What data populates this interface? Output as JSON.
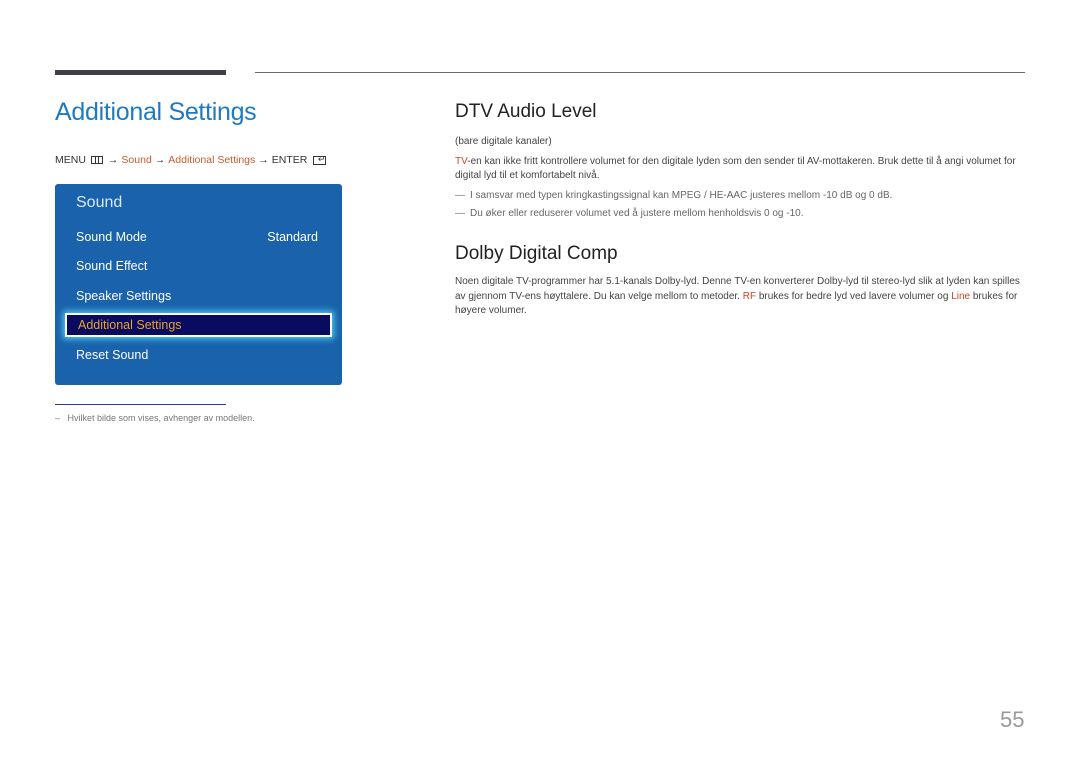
{
  "page": {
    "title": "Additional Settings",
    "page_number": "55"
  },
  "menu_path": {
    "menu_label": "MENU",
    "arrow": "→",
    "items": [
      "Sound",
      "Additional Settings"
    ],
    "enter_label": "ENTER"
  },
  "osd": {
    "title": "Sound",
    "items": [
      {
        "label": "Sound Mode",
        "value": "Standard"
      },
      {
        "label": "Sound Effect",
        "value": ""
      },
      {
        "label": "Speaker Settings",
        "value": ""
      },
      {
        "label": "Additional Settings",
        "value": "",
        "selected": true
      },
      {
        "label": "Reset Sound",
        "value": ""
      }
    ],
    "colors": {
      "panel": "#1a62ac",
      "selected_bg": "#0a0a60",
      "selected_text": "#e5a52a"
    }
  },
  "footnote": {
    "dash": "–",
    "text": "Hvilket bilde som vises, avhenger av modellen."
  },
  "dtv_audio_level": {
    "heading": "DTV Audio Level",
    "subtitle": "(bare digitale kanaler)",
    "body_highlight": "TV",
    "body_rest": "-en kan ikke fritt kontrollere volumet for den digitale lyden som den sender til AV-mottakeren. Bruk dette til å angi volumet for digital lyd til et komfortabelt nivå.",
    "notes": [
      "I samsvar med typen kringkastingssignal kan MPEG / HE-AAC justeres mellom -10 dB og 0 dB.",
      "Du øker eller reduserer volumet ved å justere mellom henholdsvis 0 og -10."
    ]
  },
  "dolby_digital_comp": {
    "heading": "Dolby Digital Comp",
    "body_part1": "Noen digitale TV-programmer har 5.1-kanals Dolby-lyd. Denne TV-en konverterer Dolby-lyd til stereo-lyd slik at lyden kan spilles av gjennom TV-ens høyttalere. Du kan velge mellom to metoder. ",
    "hl_rf": "RF",
    "body_part2": " brukes for bedre lyd ved lavere volumer og ",
    "hl_line": "Line",
    "body_part3": " brukes for høyere volumer."
  },
  "colors": {
    "title_blue": "#1f7ac1",
    "link_orange": "#c65a2e",
    "highlight_red": "#d2442a"
  }
}
